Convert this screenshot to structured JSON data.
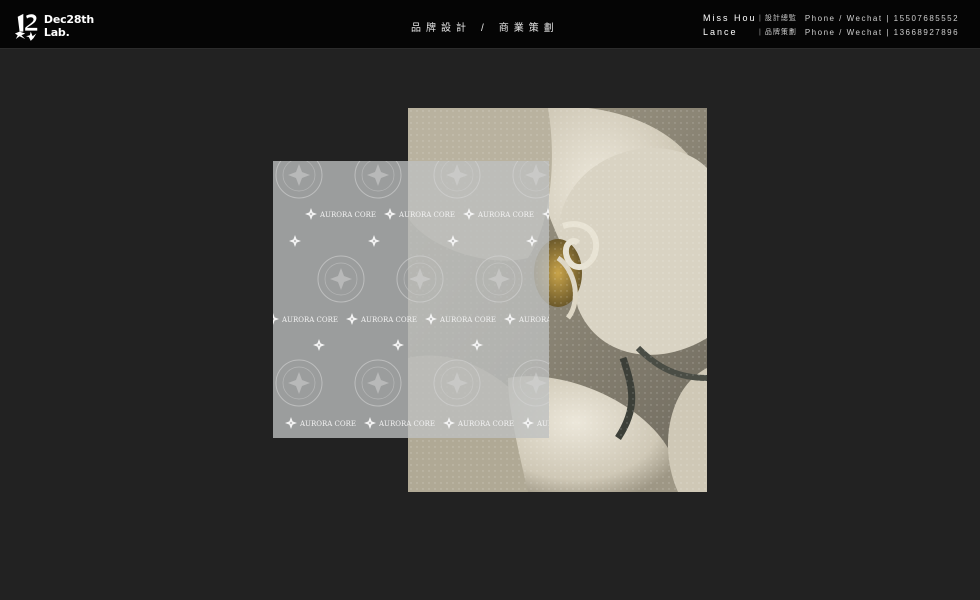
{
  "header": {
    "logo": {
      "line1": "Dec28th",
      "line2": "Lab."
    },
    "nav": [
      {
        "label": "品牌設計"
      },
      {
        "label": "商業策劃"
      }
    ],
    "nav_separator": "/",
    "contacts": [
      {
        "name": "Miss Hou",
        "role": "設計總監",
        "phone": "Phone / Wechat | 15507685552"
      },
      {
        "name": "Lance",
        "role": "品牌策劃",
        "phone": "Phone / Wechat | 13668927896"
      }
    ]
  },
  "pattern": {
    "brand_text": "AURORA CORE"
  },
  "colors": {
    "background": "#222222",
    "header": "#050505",
    "sheet": "#bebfc0",
    "petal": "#d8d2c2"
  },
  "icons": [
    "dec28th-logo-icon",
    "aurora-star-icon"
  ]
}
